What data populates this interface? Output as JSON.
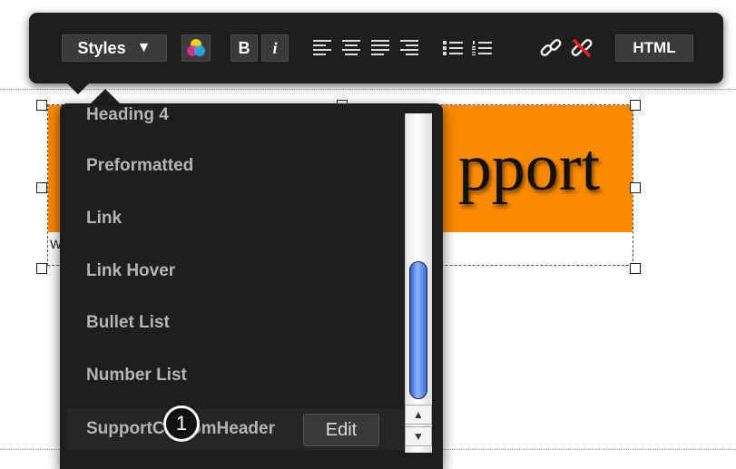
{
  "toolbar": {
    "styles_label": "Styles",
    "styles_arrow": "▼",
    "bold_label": "B",
    "italic_label": "i",
    "html_label": "HTML",
    "icons": [
      "color-picker-icon",
      "align-left-icon",
      "align-center-icon",
      "align-justify-icon",
      "align-right-icon",
      "bullet-list-icon",
      "number-list-icon",
      "link-icon",
      "unlink-icon"
    ]
  },
  "banner": {
    "text": "pport",
    "sub_text": "W",
    "background_color": "#fa8a00"
  },
  "dropdown": {
    "items": [
      {
        "label": "Heading 4"
      },
      {
        "label": "Preformatted"
      },
      {
        "label": "Link"
      },
      {
        "label": "Link Hover"
      },
      {
        "label": "Bullet List"
      },
      {
        "label": "Number List"
      },
      {
        "label": "SupportCustomHeader"
      }
    ],
    "edit_label": "Edit"
  },
  "callout": {
    "number": "1"
  },
  "scrollbar": {
    "up": "▲",
    "down": "▼"
  },
  "colors": {
    "toolbar_bg": "#1e1e1e",
    "thumb": "#4a7ae8",
    "accent": "#fa8a00"
  }
}
